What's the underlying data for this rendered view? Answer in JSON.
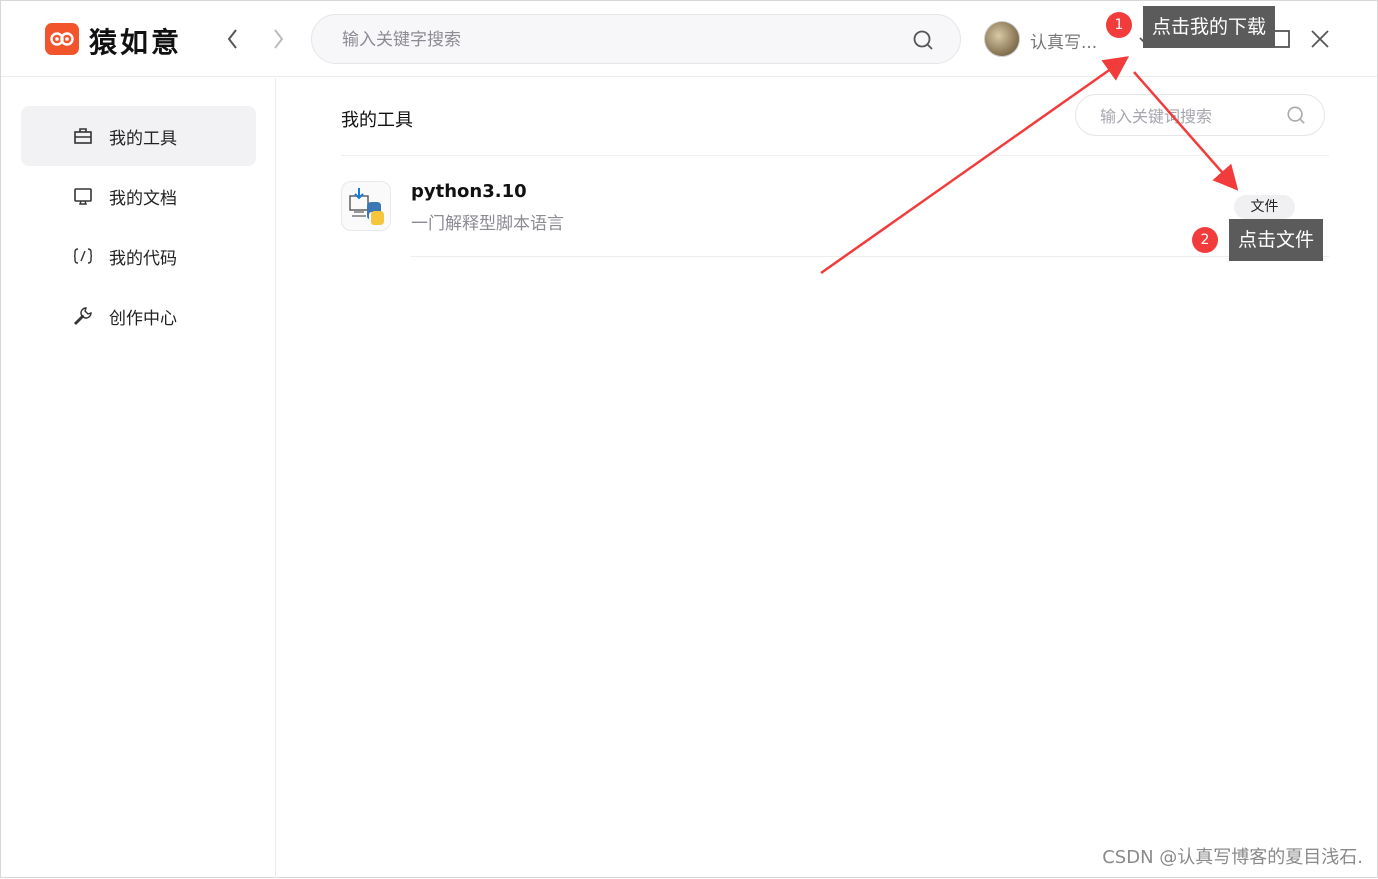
{
  "app": {
    "name": "猿如意"
  },
  "header": {
    "search_placeholder": "输入关键字搜索",
    "username": "认真写..."
  },
  "sidebar": {
    "items": [
      {
        "label": "我的工具",
        "icon": "briefcase-icon",
        "active": true
      },
      {
        "label": "我的文档",
        "icon": "monitor-icon",
        "active": false
      },
      {
        "label": "我的代码",
        "icon": "code-icon",
        "active": false
      },
      {
        "label": "创作中心",
        "icon": "wrench-icon",
        "active": false
      }
    ]
  },
  "main": {
    "title": "我的工具",
    "search_placeholder": "输入关键词搜索",
    "tools": [
      {
        "name": "python3.10",
        "description": "一门解释型脚本语言",
        "action_label": "文件"
      }
    ]
  },
  "annotations": [
    {
      "badge": "1",
      "text": "点击我的下载"
    },
    {
      "badge": "2",
      "text": "点击文件"
    }
  ],
  "watermark": "CSDN @认真写博客的夏目浅石.",
  "colors": {
    "brand": "#f2552c",
    "annotation_red": "#f23c3c",
    "tooltip_bg": "#5b5b5b"
  }
}
